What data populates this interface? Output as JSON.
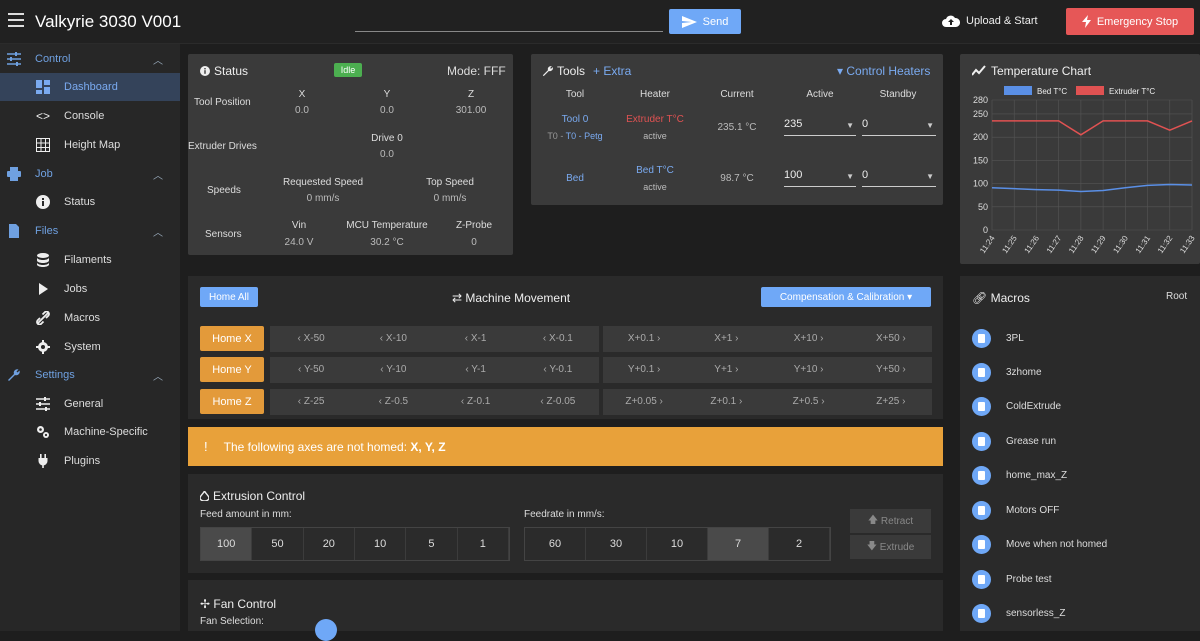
{
  "app": {
    "title": "Valkyrie 3030 V001"
  },
  "header": {
    "send_label": "Send",
    "upload_label": "Upload & Start",
    "estop_label": "Emergency Stop"
  },
  "sidebar": {
    "sections": [
      {
        "label": "Control",
        "items": [
          "Dashboard",
          "Console",
          "Height Map"
        ]
      },
      {
        "label": "Job",
        "items": [
          "Status"
        ]
      },
      {
        "label": "Files",
        "items": [
          "Filaments",
          "Jobs",
          "Macros",
          "System"
        ]
      },
      {
        "label": "Settings",
        "items": [
          "General",
          "Machine-Specific",
          "Plugins"
        ]
      }
    ]
  },
  "status": {
    "title": "Status",
    "badge": "Idle",
    "mode": "Mode: FFF",
    "tool_position_label": "Tool Position",
    "axes": [
      {
        "name": "X",
        "value": "0.0"
      },
      {
        "name": "Y",
        "value": "0.0"
      },
      {
        "name": "Z",
        "value": "301.00"
      }
    ],
    "extruder_label": "Extruder Drives",
    "drive_name": "Drive 0",
    "drive_value": "0.0",
    "speeds_label": "Speeds",
    "req_speed_label": "Requested Speed",
    "req_speed": "0 mm/s",
    "top_speed_label": "Top Speed",
    "top_speed": "0 mm/s",
    "sensors_label": "Sensors",
    "vin_label": "Vin",
    "vin": "24.0 V",
    "mcu_label": "MCU Temperature",
    "mcu": "30.2 °C",
    "probe_label": "Z-Probe",
    "probe": "0"
  },
  "tools": {
    "title": "Tools",
    "extra": "Extra",
    "control_heaters": "Control Heaters",
    "headers": [
      "Tool",
      "Heater",
      "Current",
      "Active",
      "Standby"
    ],
    "rows": [
      {
        "tool": "Tool 0",
        "subtool": "T0 - Petg",
        "heater": "Extruder T°C",
        "heater_state": "active",
        "current": "235.1 °C",
        "active": "235",
        "standby": "0"
      },
      {
        "tool": "Bed",
        "subtool": "",
        "heater": "Bed T°C",
        "heater_state": "active",
        "current": "98.7 °C",
        "active": "100",
        "standby": "0"
      }
    ]
  },
  "temp_chart": {
    "title": "Temperature Chart",
    "colors": {
      "bed": "#5a8fe6",
      "extruder": "#e05252"
    }
  },
  "chart_data": {
    "type": "line",
    "title": "Temperature Chart",
    "x": [
      "11:24",
      "11:25",
      "11:26",
      "11:27",
      "11:28",
      "11:29",
      "11:30",
      "11:31",
      "11:32",
      "11:33"
    ],
    "yticks": [
      0,
      50,
      100,
      150,
      200,
      250,
      280
    ],
    "ylim": [
      0,
      280
    ],
    "series": [
      {
        "name": "Bed T°C",
        "values": [
          91,
          89,
          87,
          86,
          83,
          85,
          91,
          96,
          98,
          97
        ]
      },
      {
        "name": "Extruder T°C",
        "values": [
          235,
          235,
          235,
          235,
          205,
          235,
          235,
          235,
          215,
          235
        ]
      }
    ],
    "legend": "top",
    "grid": true
  },
  "movement": {
    "home_all": "Home All",
    "title": "Machine Movement",
    "compensation": "Compensation & Calibration",
    "rows": [
      {
        "home": "Home X",
        "steps": [
          "X-50",
          "X-10",
          "X-1",
          "X-0.1",
          "X+0.1",
          "X+1",
          "X+10",
          "X+50"
        ]
      },
      {
        "home": "Home Y",
        "steps": [
          "Y-50",
          "Y-10",
          "Y-1",
          "Y-0.1",
          "Y+0.1",
          "Y+1",
          "Y+10",
          "Y+50"
        ]
      },
      {
        "home": "Home Z",
        "steps": [
          "Z-25",
          "Z-0.5",
          "Z-0.1",
          "Z-0.05",
          "Z+0.05",
          "Z+0.1",
          "Z+0.5",
          "Z+25"
        ]
      }
    ],
    "warning": "The following axes are not homed:",
    "warning_axes": "X, Y, Z"
  },
  "extrusion": {
    "title": "Extrusion Control",
    "feed_label": "Feed amount in mm:",
    "feed": [
      "100",
      "50",
      "20",
      "10",
      "5",
      "1"
    ],
    "rate_label": "Feedrate in mm/s:",
    "rate": [
      "60",
      "30",
      "10",
      "7",
      "2"
    ],
    "retract": "Retract",
    "extrude": "Extrude"
  },
  "fan": {
    "title": "Fan Control",
    "selection_label": "Fan Selection:"
  },
  "macros": {
    "title": "Macros",
    "root": "Root",
    "items": [
      "3PL",
      "3zhome",
      "ColdExtrude",
      "Grease run",
      "home_max_Z",
      "Motors OFF",
      "Move when not homed",
      "Probe test",
      "sensorless_Z"
    ]
  }
}
